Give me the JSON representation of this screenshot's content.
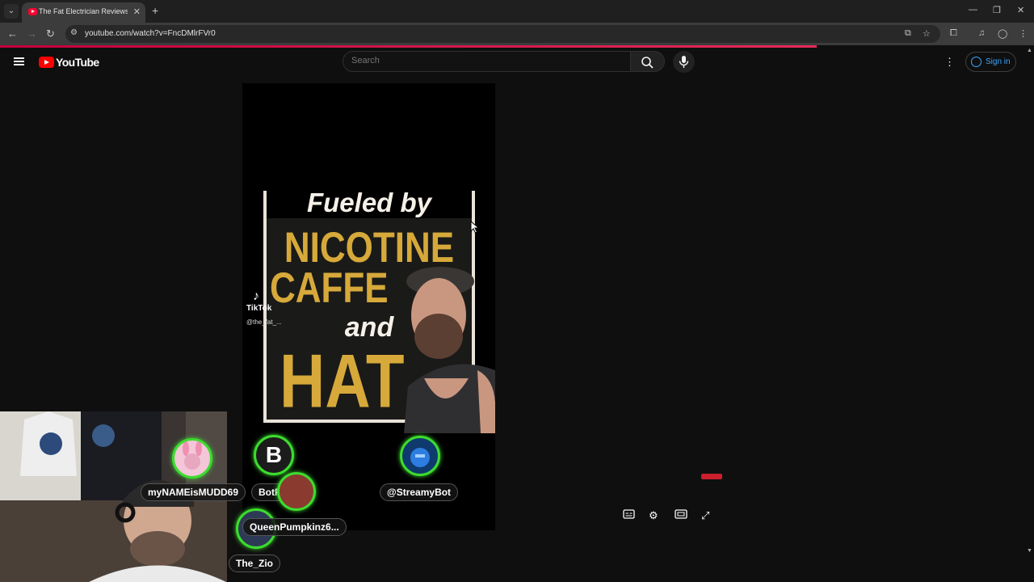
{
  "browser": {
    "tab_title": "The Fat Electrician Reviews: The",
    "url": "youtube.com/watch?v=FncDMlrFVr0",
    "load_progress": 0.79
  },
  "youtube": {
    "logo_text": "YouTube",
    "search": {
      "placeholder": "Search"
    },
    "sign_in_label": "Sign in"
  },
  "video": {
    "poster_lines": [
      "Fueled by",
      "NICOTINE",
      "CAFFE",
      "and",
      "HAT"
    ],
    "tiktok_label": "TikTok",
    "tiktok_handle": "@the_fat_..."
  },
  "player_controls": {
    "icons": [
      "subtitles-icon",
      "settings-icon",
      "theater-mode-icon",
      "fullscreen-icon"
    ]
  },
  "stream_alerts": [
    {
      "name": "myNAMEisMUDD69",
      "avatar": "pink-bunny"
    },
    {
      "name": "BotRix",
      "avatar": "B"
    },
    {
      "name": "@StreamyBot",
      "avatar": "blue-robot"
    },
    {
      "name": "QueenPumpkinz6...",
      "avatar": "dark-figure"
    },
    {
      "name": "The_Zio",
      "avatar": "none"
    }
  ],
  "colors": {
    "accent_red": "#ff0000",
    "signin_blue": "#3ea6ff",
    "alert_green": "#3ddc2f",
    "poster_gold": "#d6a93a"
  }
}
